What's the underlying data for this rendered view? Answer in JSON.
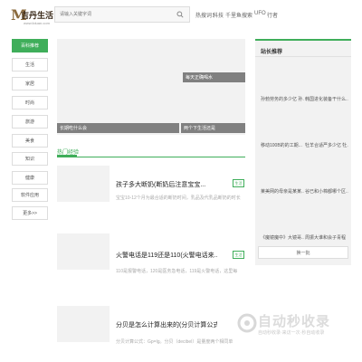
{
  "header": {
    "logo_mark": "M",
    "logo_text": "吉丹生活",
    "logo_sub": "www.liduan.com",
    "search_placeholder": "请输入关键字词",
    "hot_label": "热搜词：",
    "hot_words": [
      "科技",
      "千里鱼",
      "搜索",
      "UFO",
      "行者"
    ]
  },
  "sidebar": {
    "items": [
      {
        "label": "百科推荐",
        "active": true
      },
      {
        "label": "生活"
      },
      {
        "label": "家居"
      },
      {
        "label": "时尚"
      },
      {
        "label": "旅游"
      },
      {
        "label": "美食"
      },
      {
        "label": "知识"
      },
      {
        "label": "健康"
      },
      {
        "label": "软件应用"
      },
      {
        "label": "更多>>"
      }
    ]
  },
  "banner": {
    "captions": [
      "每天正确喝水",
      "长期吃什么会",
      "两个下生活还是"
    ]
  },
  "tab": {
    "label": "热门经验"
  },
  "articles": [
    {
      "title": "孩子多大断奶(断奶后注意宝宝...",
      "desc": "宝宝10-12个月为最合适的断奶时间，乳品及代乳品断奶的时长",
      "tag": "生活"
    },
    {
      "title": "火警电话是119还是110(火警电话来...",
      "desc": "110是报警电话，120是医务急电话，119是火警电话，这里每",
      "tag": "生活"
    },
    {
      "title": "分贝是怎么计算出来的(分贝计算公式",
      "desc": "分贝计算公式：Gp=lg。分贝（decibel）是量度两个相同单",
      "tag": ""
    }
  ],
  "right_panel": {
    "title": "站长推荐",
    "recs": [
      [
        "孙勃劳务的多少亿 孙...",
        "韩国进化装备干什么..."
      ],
      [
        "移动100B的的工期...",
        "牡羊合适严多少亿 牡..."
      ],
      [
        "莱美网的母亲是某某...",
        "谷已和小棉都哪个区..."
      ],
      [
        "《魔镜魔中》大镜哥...",
        "周振大谁和会子青程"
      ]
    ],
    "refresh_label": "换一批"
  },
  "watermark": {
    "text": "自动秒收录",
    "sub": "自动秒收录·来访一次·秒自动收录"
  },
  "colors": {
    "accent": "#3fae5a",
    "brand": "#8b6b3e"
  }
}
